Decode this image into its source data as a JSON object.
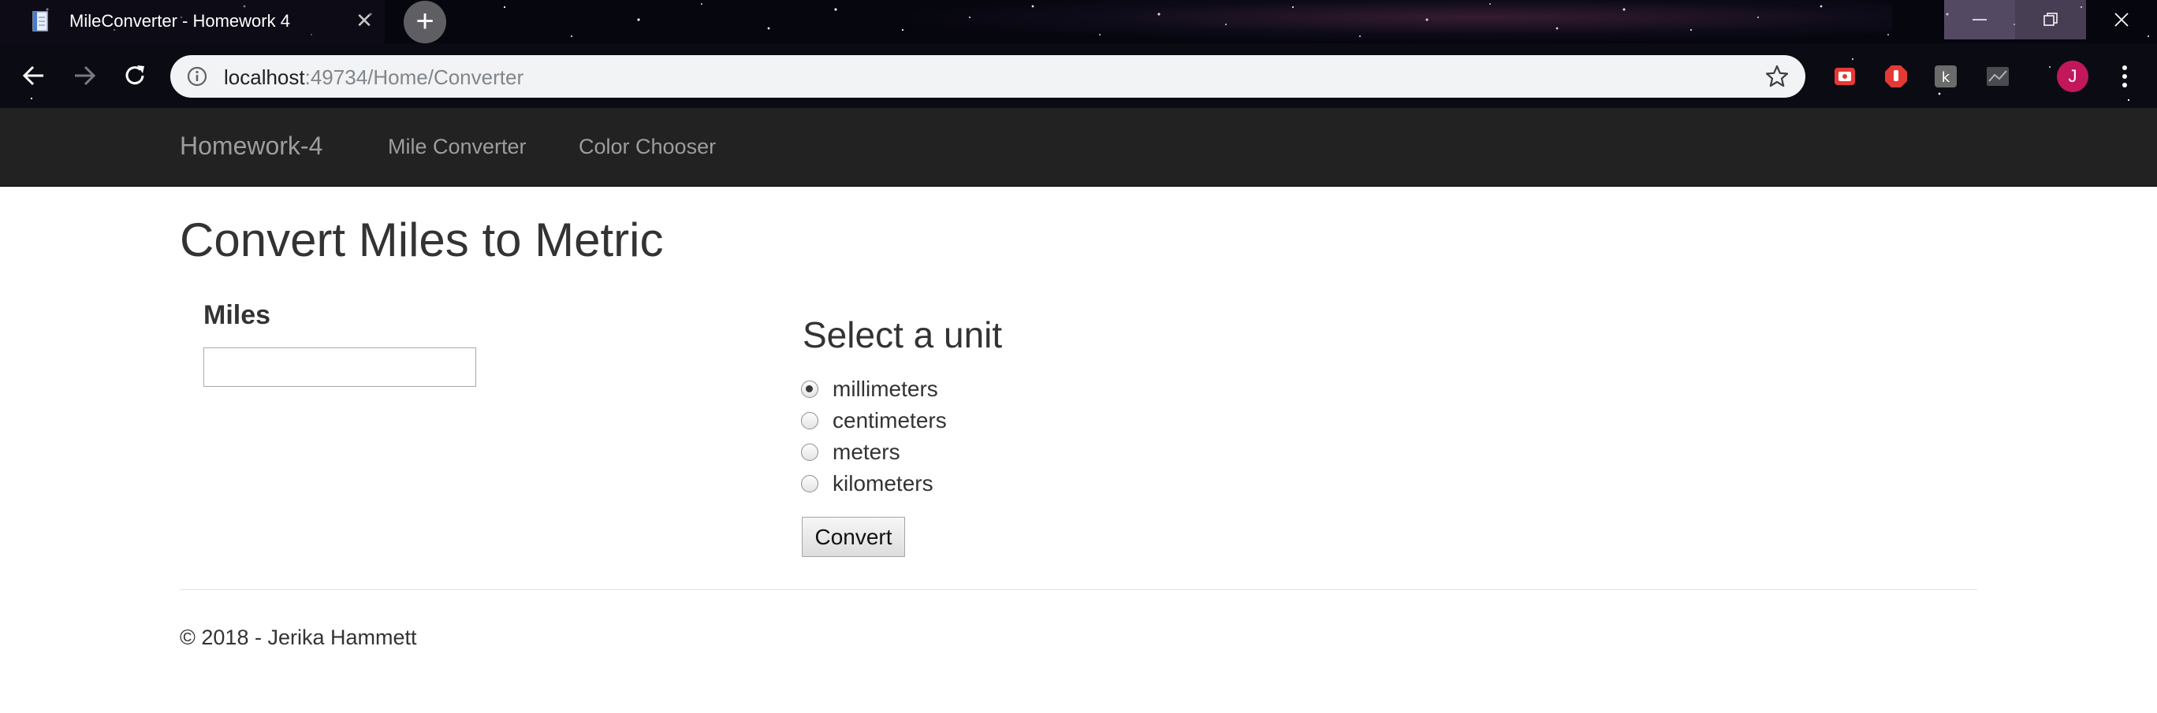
{
  "browser": {
    "tab": {
      "title": "MileConverter - Homework 4",
      "close_glyph": "✕",
      "favicon": "document-icon"
    },
    "new_tab_glyph": "+",
    "url": {
      "host": "localhost",
      "rest": ":49734/Home/Converter"
    },
    "profile_initial": "J",
    "icons": [
      "back-arrow-icon",
      "forward-arrow-icon",
      "reload-icon",
      "info-icon",
      "star-icon",
      "extension-icon",
      "menu-icon"
    ]
  },
  "navbar": {
    "brand": "Homework-4",
    "links": [
      "Mile Converter",
      "Color Chooser"
    ]
  },
  "page": {
    "title": "Convert Miles to Metric",
    "miles_label": "Miles",
    "miles_value": "",
    "unit_heading": "Select a unit",
    "units": [
      {
        "label": "millimeters",
        "checked": true
      },
      {
        "label": "centimeters",
        "checked": false
      },
      {
        "label": "meters",
        "checked": false
      },
      {
        "label": "kilometers",
        "checked": false
      }
    ],
    "convert_label": "Convert"
  },
  "footer": {
    "text": "© 2018 - Jerika Hammett"
  },
  "colors": {
    "navbar_bg": "#222222",
    "navbar_text": "#9d9d9d",
    "body_text": "#333333",
    "profile": "#c2185b"
  }
}
